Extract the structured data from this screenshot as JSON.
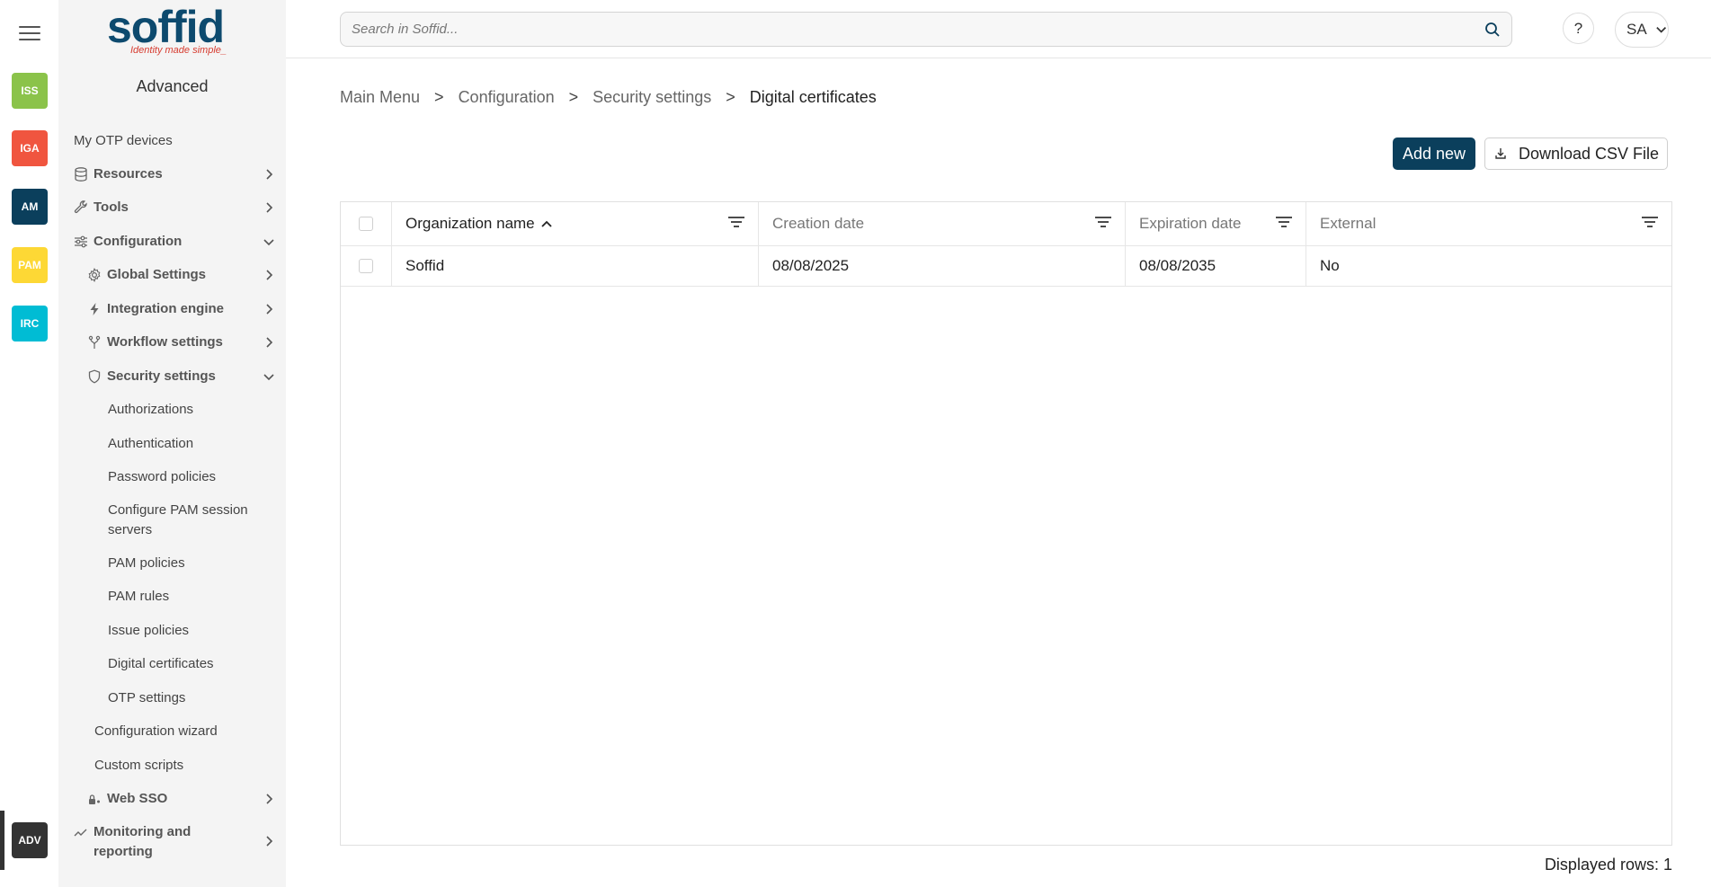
{
  "rail": {
    "apps": [
      {
        "label": "ISS",
        "color": "#8bc34a"
      },
      {
        "label": "IGA",
        "color": "#f0553f"
      },
      {
        "label": "AM",
        "color": "#0b3f5c"
      },
      {
        "label": "PAM",
        "color": "#fdd835"
      },
      {
        "label": "IRC",
        "color": "#00bcd4"
      },
      {
        "label": "ADV",
        "color": "#333333"
      }
    ]
  },
  "sidebar": {
    "logo_word": "soffid",
    "logo_tagline": "Identity made simple_",
    "title": "Advanced",
    "items": [
      {
        "label": "My OTP devices"
      },
      {
        "label": "Resources",
        "icon": "database-icon"
      },
      {
        "label": "Tools",
        "icon": "wrench-icon"
      },
      {
        "label": "Configuration",
        "icon": "sliders-icon"
      },
      {
        "label": "Global Settings",
        "icon": "gear-icon"
      },
      {
        "label": "Integration engine",
        "icon": "bolt-icon"
      },
      {
        "label": "Workflow settings",
        "icon": "branch-icon"
      },
      {
        "label": "Security settings",
        "icon": "shield-icon"
      },
      {
        "label": "Authorizations"
      },
      {
        "label": "Authentication"
      },
      {
        "label": "Password policies"
      },
      {
        "label": "Configure PAM session servers"
      },
      {
        "label": "PAM policies"
      },
      {
        "label": "PAM rules"
      },
      {
        "label": "Issue policies"
      },
      {
        "label": "Digital certificates"
      },
      {
        "label": "OTP settings"
      },
      {
        "label": "Configuration wizard"
      },
      {
        "label": "Custom scripts"
      },
      {
        "label": "Web SSO",
        "icon": "lock-key-icon"
      },
      {
        "label": "Monitoring and reporting",
        "icon": "chart-line-icon"
      }
    ]
  },
  "topbar": {
    "search_placeholder": "Search in Soffid...",
    "help_label": "?",
    "user_initials": "SA"
  },
  "breadcrumb": {
    "items": [
      "Main Menu",
      "Configuration",
      "Security settings",
      "Digital certificates"
    ],
    "separator": ">"
  },
  "actions": {
    "add_new": "Add new",
    "download_csv": "Download CSV File"
  },
  "table": {
    "columns": [
      "Organization name",
      "Creation date",
      "Expiration date",
      "External"
    ],
    "rows": [
      [
        "Soffid",
        "08/08/2025",
        "08/08/2035",
        "No"
      ]
    ]
  },
  "footer": {
    "displayed_rows": "Displayed rows: 1"
  }
}
